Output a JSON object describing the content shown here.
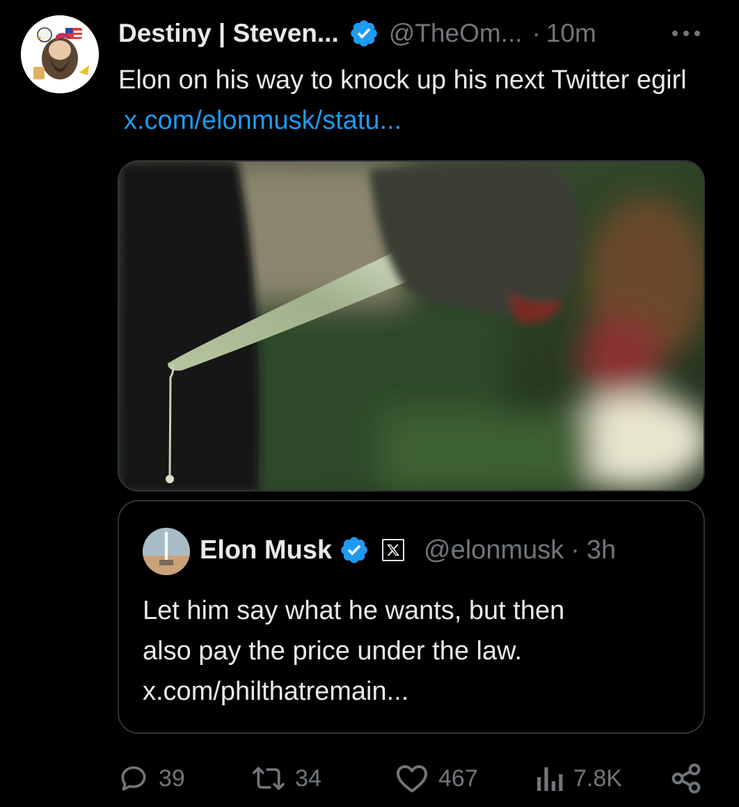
{
  "tweet": {
    "author": {
      "display_name": "Destiny | Steven...",
      "handle": "@TheOm...",
      "verified": true,
      "avatar": "cartoon-avatar-icon"
    },
    "separator": "·",
    "time": "10m",
    "more_icon": "more-horizontal-icon",
    "text": "Elon on his way to knock up his next Twitter egirl",
    "link": "x.com/elonmusk/statu..."
  },
  "media": {
    "description_icon": "photo-knife-image"
  },
  "quoted_tweet": {
    "author": {
      "display_name": "Elon Musk",
      "handle": "@elonmusk",
      "verified": true,
      "affiliate_badge": "X"
    },
    "separator": "·",
    "time": "3h",
    "text_line1": "Let him say what he wants, but then",
    "text_line2": "also pay the price under the law.",
    "text_line3": "x.com/philthatremain..."
  },
  "actions": {
    "reply": {
      "icon": "reply-icon",
      "count": "39"
    },
    "retweet": {
      "icon": "retweet-icon",
      "count": "34"
    },
    "like": {
      "icon": "heart-icon",
      "count": "467"
    },
    "views": {
      "icon": "views-chart-icon",
      "count": "7.8K"
    },
    "share": {
      "icon": "share-icon"
    }
  },
  "colors": {
    "background": "#000000",
    "text_primary": "#e7e9ea",
    "text_secondary": "#71767b",
    "link": "#1d9bf0",
    "verified": "#1d9bf0",
    "border": "#2f3336"
  }
}
